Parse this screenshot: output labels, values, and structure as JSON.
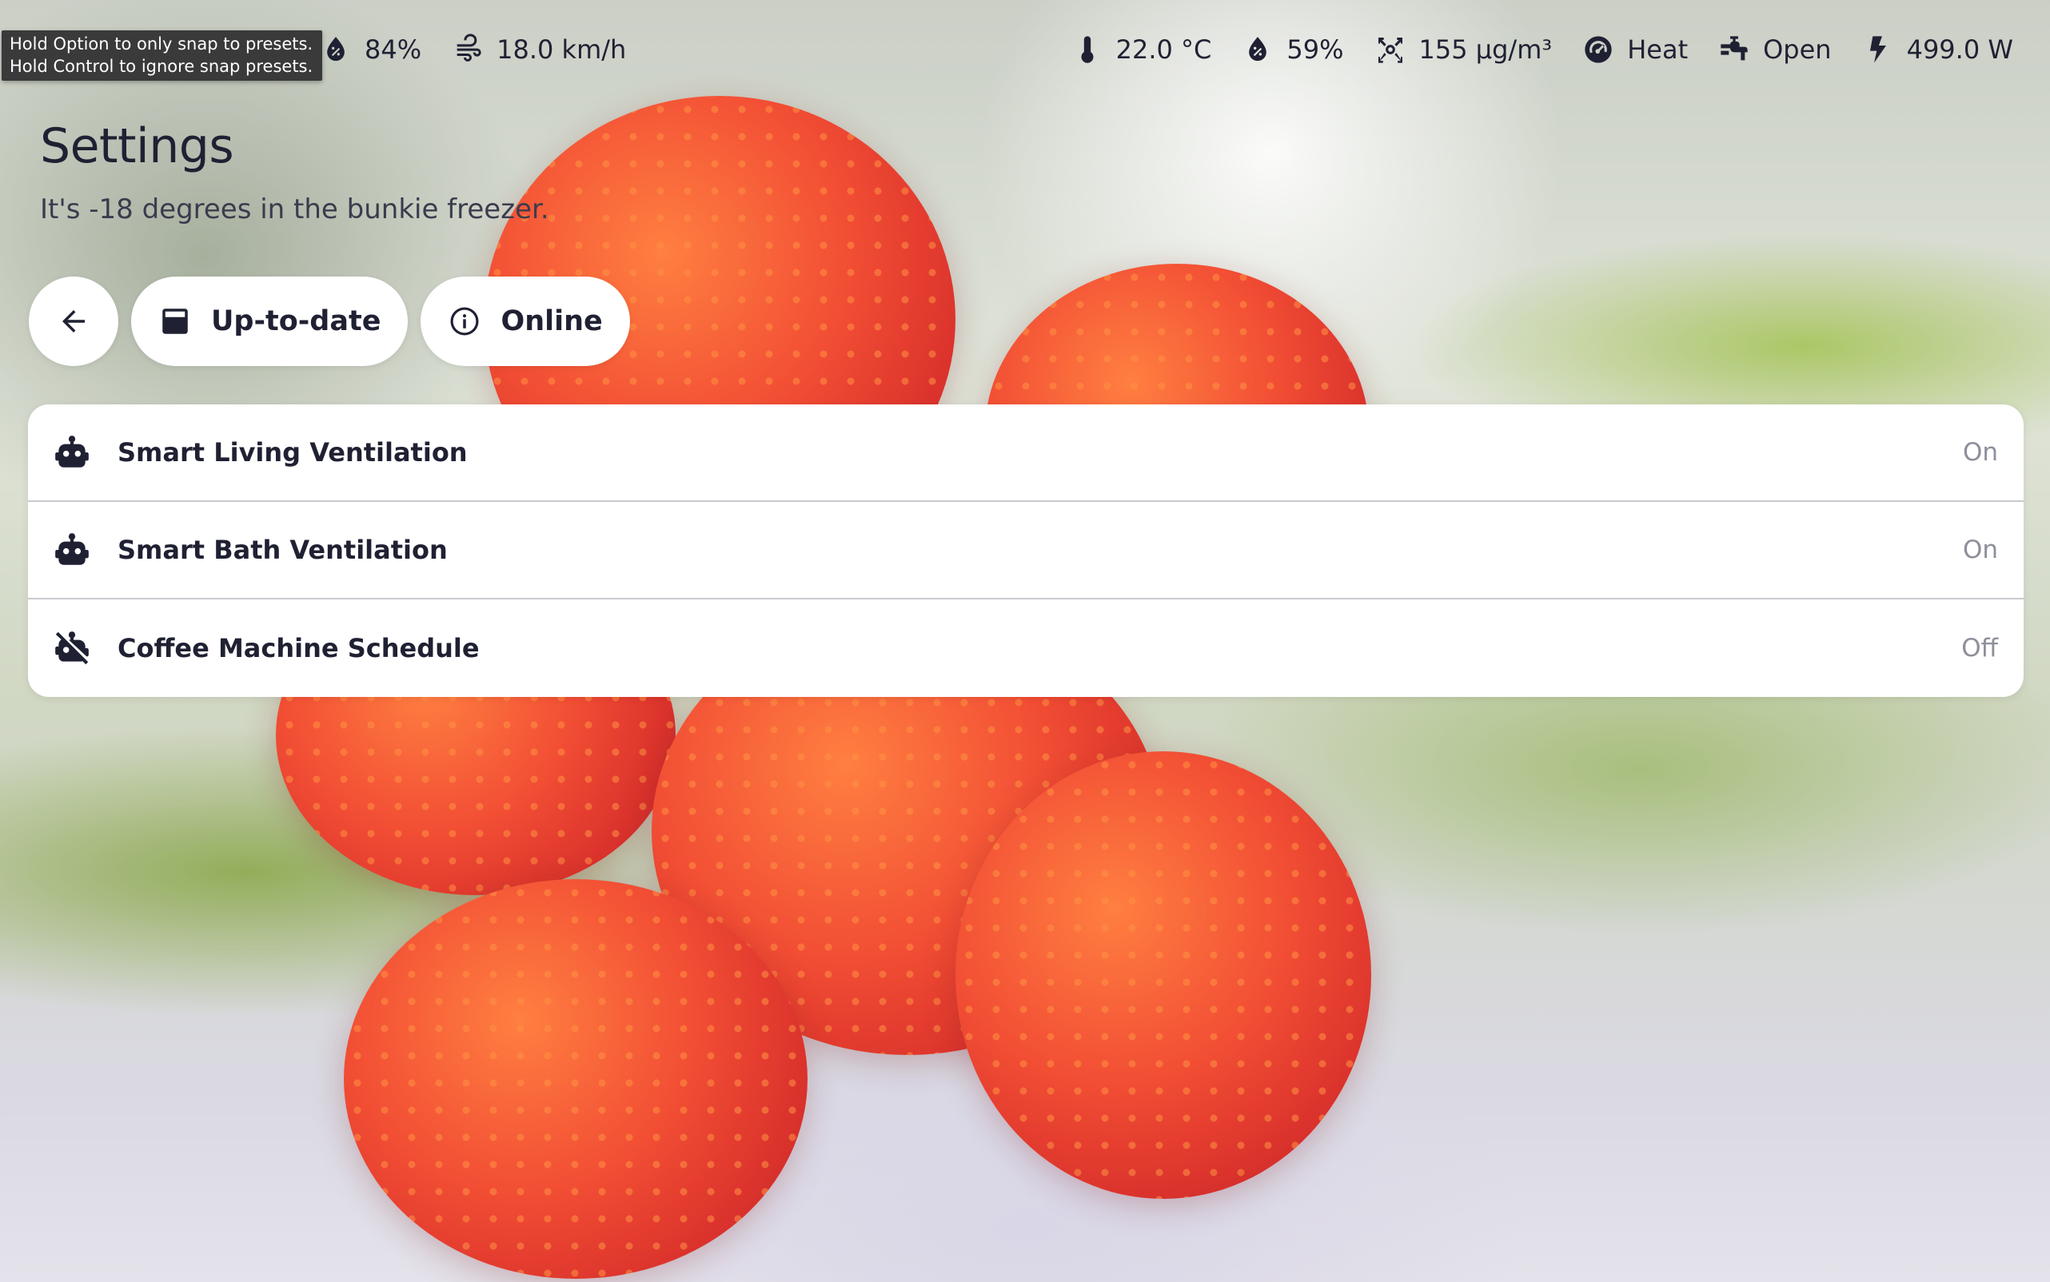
{
  "tooltip": {
    "line1": "Hold Option to only snap to presets.",
    "line2": "Hold Control to ignore snap presets."
  },
  "status_left": [
    {
      "icon": "water-drop-icon",
      "value": "84%"
    },
    {
      "icon": "wind-icon",
      "value": "18.0 km/h"
    }
  ],
  "status_right": [
    {
      "icon": "thermometer-icon",
      "value": "22.0 °C"
    },
    {
      "icon": "water-drop-icon",
      "value": "59%"
    },
    {
      "icon": "molecule-icon",
      "value": "155 µg/m³"
    },
    {
      "icon": "heat-gauge-icon",
      "value": "Heat"
    },
    {
      "icon": "valve-icon",
      "value": "Open"
    },
    {
      "icon": "lightning-bolt-icon",
      "value": "499.0 W"
    }
  ],
  "header": {
    "title": "Settings",
    "subtitle": "It's -18 degrees in the bunkie freezer."
  },
  "chips": {
    "back_icon": "arrow-left-icon",
    "update_label": "Up-to-date",
    "update_icon": "package-icon",
    "online_label": "Online",
    "online_icon": "info-icon"
  },
  "automations": [
    {
      "icon": "robot-icon",
      "label": "Smart Living Ventilation",
      "state": "On"
    },
    {
      "icon": "robot-icon",
      "label": "Smart Bath Ventilation",
      "state": "On"
    },
    {
      "icon": "robot-off-icon",
      "label": "Coffee Machine Schedule",
      "state": "Off"
    }
  ],
  "colors": {
    "text": "#1f2133",
    "muted": "#8d8f9a",
    "card": "#ffffff",
    "fruit": "#e8392a"
  }
}
